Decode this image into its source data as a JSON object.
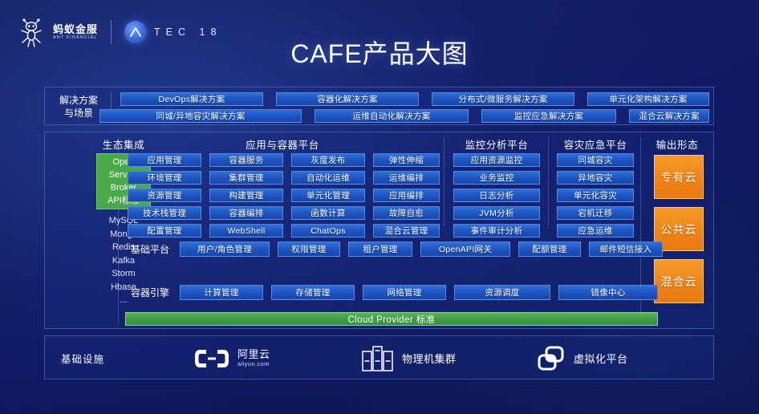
{
  "header": {
    "brand_cn": "蚂蚁金服",
    "brand_en": "ANT FINANCIAL",
    "event_letters": "TEC 18",
    "title": "CAFE产品大图"
  },
  "solutions": {
    "label_line1": "解决方案",
    "label_line2": "与场景",
    "row1": [
      "DevOps解决方案",
      "容器化解决方案",
      "分布式/微服务解决方案",
      "单元化架构解决方案"
    ],
    "row2": [
      "同城/异地容灾解决方案",
      "运维自动化解决方案",
      "监控应急解决方案",
      "混合云解决方案"
    ]
  },
  "ecosystem": {
    "title": "生态集成",
    "highlight": [
      "Open",
      "Service",
      "Broker",
      "API标准"
    ],
    "items": [
      "MySQL",
      "Mongo",
      "Redis",
      "Kafka",
      "Storm",
      "Hbase",
      "..."
    ]
  },
  "app_platform": {
    "title": "应用与容器平台",
    "columns": [
      [
        "应用管理",
        "环境管理",
        "资源管理",
        "技术栈管理",
        "配置管理"
      ],
      [
        "容器服务",
        "集群管理",
        "构建管理",
        "容器编排",
        "WebShell"
      ],
      [
        "灰度发布",
        "自动化运维",
        "单元化管理",
        "函数计算",
        "ChatOps"
      ],
      [
        "弹性伸缩",
        "运维编排",
        "应用编排",
        "故障自愈",
        "混合云管理"
      ]
    ]
  },
  "monitor_platform": {
    "title": "监控分析平台",
    "items": [
      "应用资源监控",
      "业务监控",
      "日志分析",
      "JVM分析",
      "事件审计分析"
    ]
  },
  "dr_platform": {
    "title": "容灾应急平台",
    "items": [
      "同城容灾",
      "异地容灾",
      "单元化容灾",
      "宕机迁移",
      "应急运维"
    ]
  },
  "output_forms": {
    "title": "输出形态",
    "items": [
      "专有云",
      "公共云",
      "混合云"
    ]
  },
  "base_platform": {
    "label": "基础平台",
    "items": [
      "用户/角色管理",
      "权限管理",
      "租户管理",
      "OpenAPI网关",
      "配额管理",
      "邮件短信接入"
    ]
  },
  "container_engine": {
    "label": "容器引擎",
    "items": [
      "计算管理",
      "存储管理",
      "网络管理",
      "资源调度",
      "镜像中心"
    ],
    "cloud_provider_bar": "Cloud Provider 标准"
  },
  "infrastructure": {
    "label": "基础设施",
    "items": [
      {
        "name": "阿里云",
        "sub": "aliyun.com",
        "icon": "aliyun-logo-icon"
      },
      {
        "name": "物理机集群",
        "icon": "server-rack-icon"
      },
      {
        "name": "虚拟化平台",
        "icon": "vmware-squares-icon"
      }
    ]
  },
  "colors": {
    "background": "#111a5c",
    "button_blue": "#1e56c2",
    "accent_green": "#49a847",
    "accent_orange": "#ef8416",
    "panel_border": "#78a0eb"
  }
}
